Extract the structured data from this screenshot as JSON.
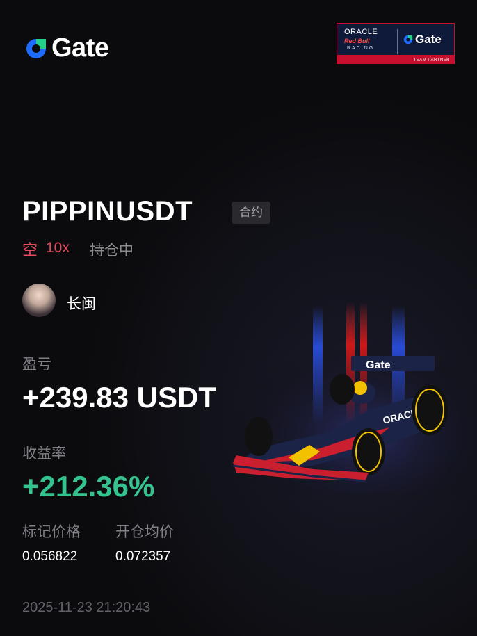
{
  "brand": {
    "logo_text": "Gate"
  },
  "partner_badge": {
    "oracle": "ORACLE",
    "red_bull": "Red Bull",
    "racing": "RACING",
    "gate": "Gate",
    "team_partner": "TEAM PARTNER"
  },
  "position": {
    "symbol": "PIPPINUSDT",
    "tag": "合约",
    "side": "空",
    "leverage": "10x",
    "status": "持仓中"
  },
  "user": {
    "name": "长闽"
  },
  "pnl": {
    "label": "盈亏",
    "value": "+239.83 USDT"
  },
  "roi": {
    "label": "收益率",
    "value": "+212.36%"
  },
  "prices": {
    "mark_label": "标记价格",
    "mark_value": "0.056822",
    "open_label": "开仓均价",
    "open_value": "0.072357"
  },
  "timestamp": "2025-11-23 21:20:43",
  "car_livery_text": {
    "wing": "Gate",
    "sidepod": "ORACLE"
  },
  "colors": {
    "short": "#e64a5f",
    "profit": "#34c38f",
    "muted": "#7f7f86",
    "accent_blue": "#1e6bff",
    "accent_green": "#23d18b"
  }
}
